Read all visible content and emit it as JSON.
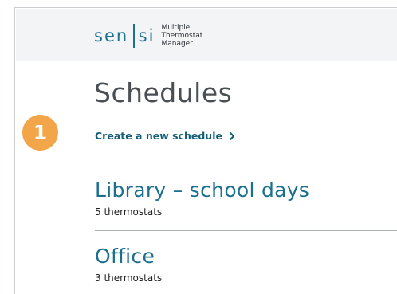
{
  "header": {
    "logo_left": "sen",
    "logo_right": "si",
    "product_line1": "Multiple Thermostat",
    "product_line2": "Manager"
  },
  "page": {
    "title": "Schedules",
    "step_number": "1",
    "create_link": "Create a new schedule",
    "create_link_icon": "chevron-right-icon"
  },
  "schedules": [
    {
      "name": "Library – school days",
      "count": "5 thermostats"
    },
    {
      "name": "Office",
      "count": "3 thermostats"
    }
  ],
  "colors": {
    "brand": "#1b6f8f",
    "link": "#155e78",
    "badge": "#f2a649",
    "header_bg": "#f2f4f6",
    "title": "#4a4f54"
  }
}
